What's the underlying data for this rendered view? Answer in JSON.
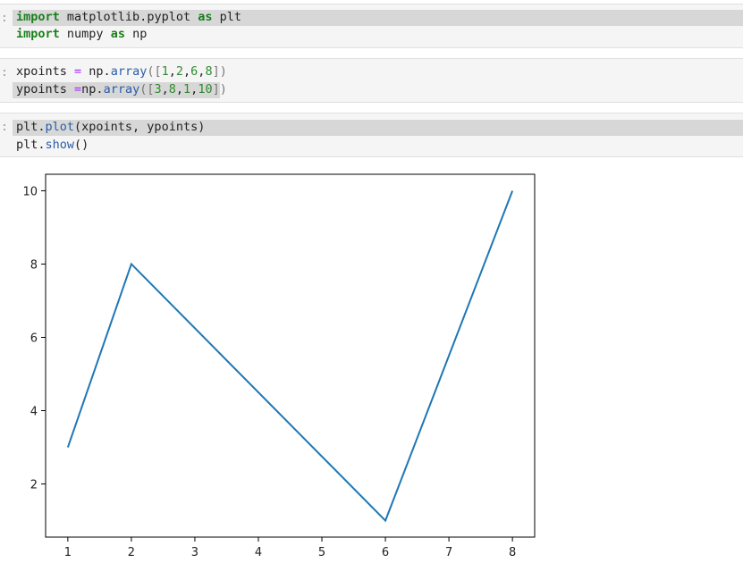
{
  "cells": [
    {
      "prompt": ":",
      "lines": [
        {
          "tokens": [
            {
              "t": "import",
              "c": "kw"
            },
            {
              "t": " matplotlib.pyplot ",
              "c": ""
            },
            {
              "t": "as",
              "c": "kw"
            },
            {
              "t": " plt",
              "c": ""
            }
          ]
        },
        {
          "tokens": [
            {
              "t": "import",
              "c": "kw"
            },
            {
              "t": " numpy ",
              "c": ""
            },
            {
              "t": "as",
              "c": "kw"
            },
            {
              "t": " np",
              "c": ""
            }
          ]
        }
      ]
    },
    {
      "prompt": ":",
      "lines": [
        {
          "tokens": [
            {
              "t": "xpoints ",
              "c": ""
            },
            {
              "t": "=",
              "c": "op"
            },
            {
              "t": " np.",
              "c": ""
            },
            {
              "t": "array",
              "c": "fn"
            },
            {
              "t": "([",
              "c": "br"
            },
            {
              "t": "1",
              "c": "num"
            },
            {
              "t": ",",
              "c": ""
            },
            {
              "t": "2",
              "c": "num"
            },
            {
              "t": ",",
              "c": ""
            },
            {
              "t": "6",
              "c": "num"
            },
            {
              "t": ",",
              "c": ""
            },
            {
              "t": "8",
              "c": "num"
            },
            {
              "t": "])",
              "c": "br"
            }
          ]
        },
        {
          "tokens": [
            {
              "t": "ypoints ",
              "c": ""
            },
            {
              "t": "=",
              "c": "op"
            },
            {
              "t": "np.",
              "c": ""
            },
            {
              "t": "array",
              "c": "fn"
            },
            {
              "t": "([",
              "c": "br"
            },
            {
              "t": "3",
              "c": "num"
            },
            {
              "t": ",",
              "c": ""
            },
            {
              "t": "8",
              "c": "num"
            },
            {
              "t": ",",
              "c": ""
            },
            {
              "t": "1",
              "c": "num"
            },
            {
              "t": ",",
              "c": ""
            },
            {
              "t": "10",
              "c": "num"
            },
            {
              "t": "])",
              "c": "br"
            }
          ]
        }
      ]
    },
    {
      "prompt": ":",
      "lines": [
        {
          "tokens": [
            {
              "t": "plt.",
              "c": ""
            },
            {
              "t": "plot",
              "c": "fn"
            },
            {
              "t": "(xpoints, ypoints)",
              "c": ""
            }
          ]
        },
        {
          "tokens": [
            {
              "t": "plt.",
              "c": ""
            },
            {
              "t": "show",
              "c": "fn"
            },
            {
              "t": "()",
              "c": ""
            }
          ]
        }
      ]
    }
  ],
  "chart_data": {
    "type": "line",
    "x": [
      1,
      2,
      6,
      8
    ],
    "series": [
      {
        "values": [
          3,
          8,
          1,
          10
        ]
      }
    ],
    "xticks": [
      1,
      2,
      3,
      4,
      5,
      6,
      7,
      8
    ],
    "yticks": [
      2,
      4,
      6,
      8,
      10
    ],
    "xlim": [
      0.65,
      8.35
    ],
    "ylim": [
      0.55,
      10.45
    ],
    "line_color": "#1f77b4",
    "grid": false
  }
}
